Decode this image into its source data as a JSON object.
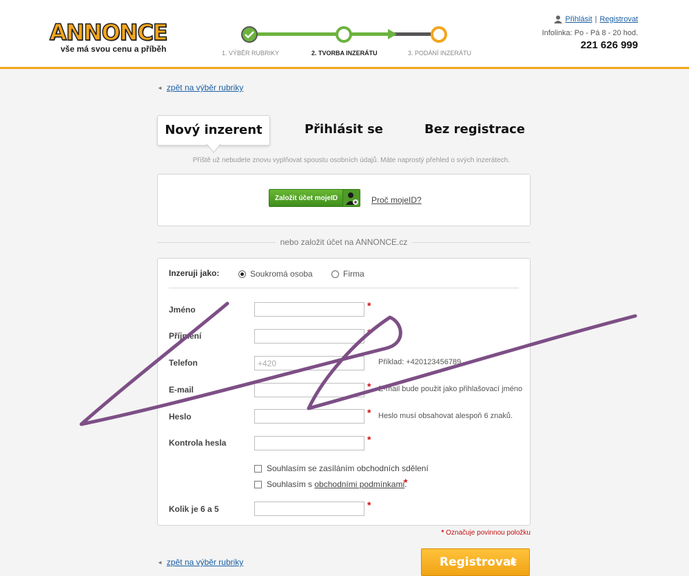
{
  "header": {
    "logo_word": "ANNONCE",
    "logo_tagline": "vše má svou cenu a příběh",
    "steps": [
      {
        "label": "1. Výběr rubriky"
      },
      {
        "label": "2. Tvorba inzerátu"
      },
      {
        "label": "3. Podání inzerátu"
      }
    ],
    "login_link": "Přihlásit",
    "separator": "|",
    "register_link": "Registrovat",
    "infoline": "Infolinka: Po - Pá 8 - 20 hod.",
    "phone": "221 626 999"
  },
  "back_link_top": "zpět na výběr rubriky",
  "tabs": [
    {
      "label": "Nový inzerent"
    },
    {
      "label": "Přihlásit se"
    },
    {
      "label": "Bez registrace"
    }
  ],
  "tab_hint": "Příště už nebudete znovu vyplňovat spoustu osobních údajů. Máte naprostý přehled o svých inzerátech.",
  "mojeid": {
    "button_label": "Založit účet mojeID",
    "why_link": "Proč mojeID?"
  },
  "divider_text": "nebo založit účet na ANNONCE.cz",
  "form": {
    "as_label": "Inzeruji jako:",
    "options": [
      "Soukromá osoba",
      "Firma"
    ],
    "fields": {
      "first_name": {
        "label": "Jméno",
        "value": ""
      },
      "last_name": {
        "label": "Příjmení",
        "value": ""
      },
      "phone": {
        "label": "Telefon",
        "value": "+420",
        "hint": "Příklad: +420123456789"
      },
      "email": {
        "label": "E-mail",
        "value": "",
        "hint": "E-mail bude použit jako přihlašovací jméno"
      },
      "password": {
        "label": "Heslo",
        "value": "",
        "hint": "Heslo musí obsahovat alespoň 6 znaků."
      },
      "password_check": {
        "label": "Kontrola hesla",
        "value": ""
      },
      "captcha": {
        "label": "Kolik je 6 a 5",
        "value": ""
      }
    },
    "checkbox_marketing": "Souhlasím se zasíláním obchodních sdělení",
    "checkbox_terms_prefix": "Souhlasím s",
    "checkbox_terms_link": "obchodními podmínkami",
    "checkbox_terms_suffix": ".",
    "required_star": "*"
  },
  "required_note": "Označuje povinnou položku",
  "back_link_bottom": "zpět na výběr rubriky",
  "register_button": "Registrovat",
  "colors": {
    "accent_orange": "#f4a51c",
    "green_progress": "#6cb33f",
    "link_blue": "#1b5fa5",
    "required_red": "#d01010",
    "scribble_purple": "#7d4f86"
  }
}
